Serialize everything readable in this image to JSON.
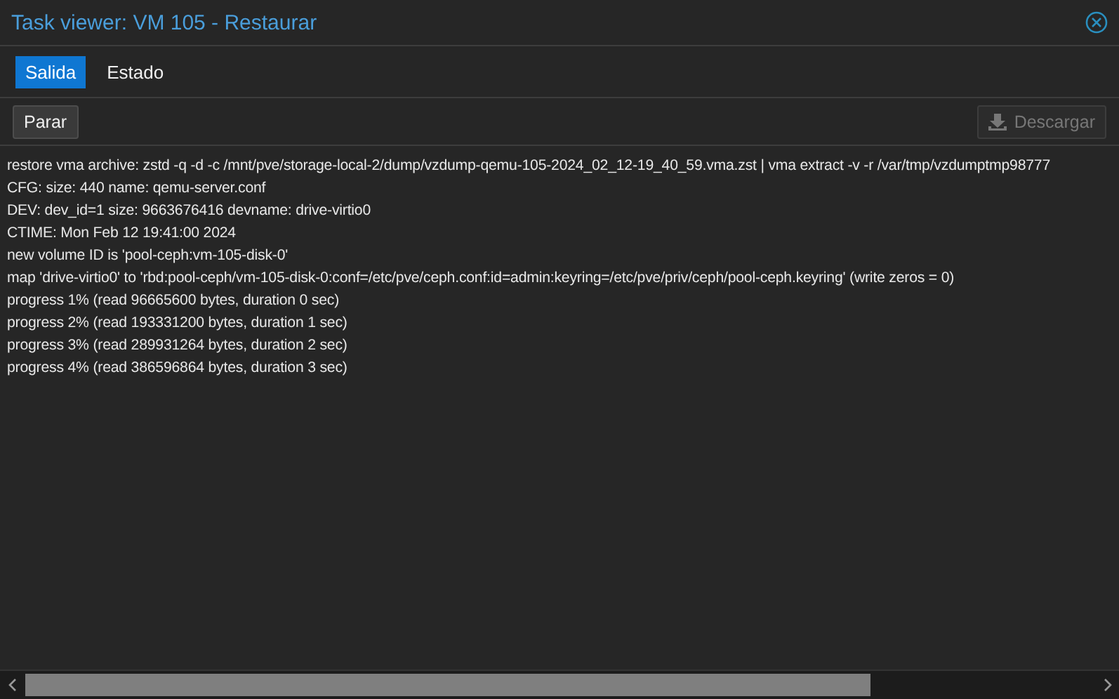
{
  "window": {
    "title": "Task viewer: VM 105 - Restaurar"
  },
  "tabs": [
    {
      "label": "Salida",
      "selected": true
    },
    {
      "label": "Estado",
      "selected": false
    }
  ],
  "toolbar": {
    "buttons": [
      {
        "label": "Parar",
        "disabled": false,
        "kind": "plain"
      },
      {
        "label": "Descargar",
        "disabled": true,
        "kind": "download"
      }
    ]
  },
  "log": [
    "restore vma archive: zstd -q -d -c /mnt/pve/storage-local-2/dump/vzdump-qemu-105-2024_02_12-19_40_59.vma.zst | vma extract -v -r /var/tmp/vzdumptmp98777",
    "CFG: size: 440 name: qemu-server.conf",
    "DEV: dev_id=1 size: 9663676416 devname: drive-virtio0",
    "CTIME: Mon Feb 12 19:41:00 2024",
    "new volume ID is 'pool-ceph:vm-105-disk-0'",
    "map 'drive-virtio0' to 'rbd:pool-ceph/vm-105-disk-0:conf=/etc/pve/ceph.conf:id=admin:keyring=/etc/pve/priv/ceph/pool-ceph.keyring' (write zeros = 0)",
    "progress 1% (read 96665600 bytes, duration 0 sec)",
    "progress 2% (read 193331200 bytes, duration 1 sec)",
    "progress 3% (read 289931264 bytes, duration 2 sec)",
    "progress 4% (read 386596864 bytes, duration 3 sec)"
  ]
}
